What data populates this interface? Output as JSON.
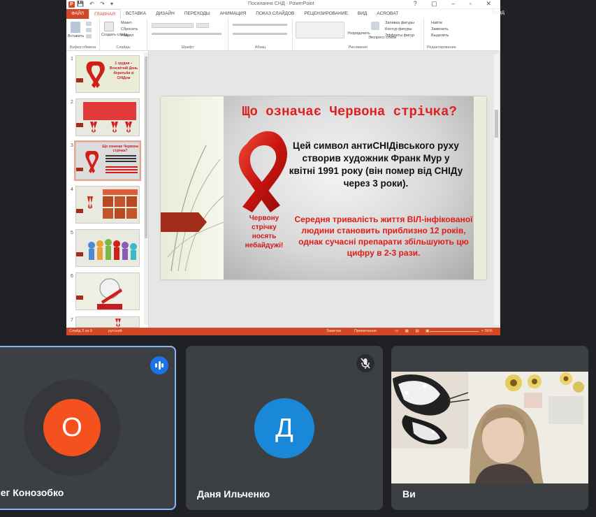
{
  "ppt": {
    "window_title": "Посилання СНД - PowerPoint",
    "qat_symbols": "💾 ↶ ↷ ▾",
    "window_controls": "? ▢ – ▫ ✕",
    "right_user": "Вход",
    "tabs": [
      "Файл",
      "Главная",
      "Вставка",
      "Дизайн",
      "Переходы",
      "Анимация",
      "Показ слайдов",
      "Рецензирование",
      "Вид",
      "Acrobat"
    ],
    "ribbon": {
      "paste": "Вставить",
      "create_slide": "Создать слайд",
      "layout": "Макет",
      "reset": "Сбросить",
      "section": "Раздел",
      "arrange": "Упорядочить",
      "quick_styles": "Экспресс-стили",
      "shape_fill": "Заливка фигуры",
      "shape_outline": "Контур фигуры",
      "shape_effects": "Эффекты фигур",
      "find": "Найти",
      "replace": "Заменить",
      "select": "Выделить",
      "groups": [
        "Буфер обмена",
        "Слайды",
        "Шрифт",
        "Абзац",
        "Рисование",
        "Редактирование"
      ]
    },
    "thumb_numbers": [
      "1",
      "2",
      "3",
      "4",
      "5",
      "6",
      "7"
    ],
    "thumb1_text": "1 грудня – Всесвітній День боротьби зі СНІДом",
    "thumb3_text": "Що означає Червона стрічка?",
    "slide": {
      "heading": "Що означає Червона стрічка?",
      "desc": "Цей символ антиСНІДівського руху створив художник Франк Мур у квітні 1991 року (він помер від СНІДу через 3 роки).",
      "note": "Середня тривалість життя ВІЛ-інфікованої людини становить приблизно 12 років, однак сучасні препарати збільшують цю цифру в 2-3 рази.",
      "ribbon_caption": "Червону стрічку носять небайдужі!"
    },
    "status": {
      "slide_count": "Слайд 3 из 9",
      "language": "русский",
      "notes": "Заметки",
      "comments": "Примечания",
      "zoom": "+ 56%"
    }
  },
  "participants": [
    {
      "name": "лег Конозобко",
      "initial": "О",
      "color": "#f4511e",
      "state": "speaking"
    },
    {
      "name": "Даня Ильченко",
      "initial": "Д",
      "color": "#1a88d8",
      "state": "muted"
    },
    {
      "name": "Ви",
      "initial": "",
      "color": "",
      "state": "video"
    }
  ],
  "colors": {
    "accent_ppt": "#d24726",
    "meet_bg": "#202124",
    "tile_bg": "#3c4043",
    "active_border": "#8ab4f8"
  }
}
